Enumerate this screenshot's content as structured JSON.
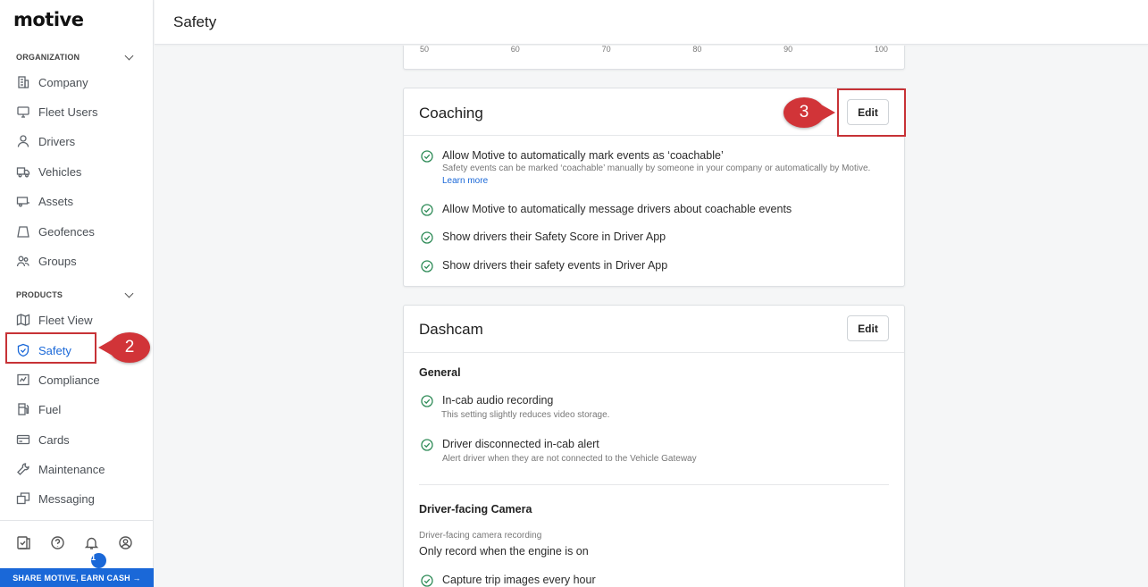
{
  "brand": {
    "logo_text": "motive"
  },
  "sidebar": {
    "organization_label": "ORGANIZATION",
    "products_label": "PRODUCTS",
    "org_items": [
      {
        "label": "Company",
        "icon": "building-icon"
      },
      {
        "label": "Fleet Users",
        "icon": "monitor-icon"
      },
      {
        "label": "Drivers",
        "icon": "person-icon"
      },
      {
        "label": "Vehicles",
        "icon": "truck-icon"
      },
      {
        "label": "Assets",
        "icon": "trailer-icon"
      },
      {
        "label": "Geofences",
        "icon": "geofence-icon"
      },
      {
        "label": "Groups",
        "icon": "group-icon"
      }
    ],
    "product_items": [
      {
        "label": "Fleet View",
        "icon": "map-icon"
      },
      {
        "label": "Safety",
        "icon": "shield-icon",
        "active": true
      },
      {
        "label": "Compliance",
        "icon": "compliance-icon"
      },
      {
        "label": "Fuel",
        "icon": "fuel-icon"
      },
      {
        "label": "Cards",
        "icon": "card-icon"
      },
      {
        "label": "Maintenance",
        "icon": "wrench-icon"
      },
      {
        "label": "Messaging",
        "icon": "messaging-icon"
      }
    ],
    "notification_count": "1",
    "share_label": "SHARE MOTIVE, EARN CASH →"
  },
  "header": {
    "title": "Safety"
  },
  "score_scale": [
    "50",
    "60",
    "70",
    "80",
    "90",
    "100"
  ],
  "coaching": {
    "title": "Coaching",
    "edit_label": "Edit",
    "items": [
      {
        "text": "Allow Motive to automatically mark events as ‘coachable’",
        "sub": "Safety events can be marked ‘coachable’ manually by someone in your company or automatically by Motive.",
        "link": "Learn more"
      },
      {
        "text": "Allow Motive to automatically message drivers about coachable events"
      },
      {
        "text": "Show drivers their Safety Score in Driver App"
      },
      {
        "text": "Show drivers their safety events in Driver App"
      }
    ]
  },
  "dashcam": {
    "title": "Dashcam",
    "edit_label": "Edit",
    "general_label": "General",
    "general_items": [
      {
        "text": "In-cab audio recording",
        "sub": "This setting slightly reduces video storage."
      },
      {
        "text": "Driver disconnected in-cab alert",
        "sub": "Alert driver when they are not connected to the Vehicle Gateway"
      }
    ],
    "driver_facing_label": "Driver-facing Camera",
    "recording_label": "Driver-facing camera recording",
    "recording_value": "Only record when the engine is on",
    "trip_images": "Capture trip images every hour"
  },
  "annotations": {
    "step2": "2",
    "step3": "3"
  },
  "colors": {
    "accent": "#1a68d8",
    "callout": "#d13438",
    "check": "#2e8b57"
  }
}
